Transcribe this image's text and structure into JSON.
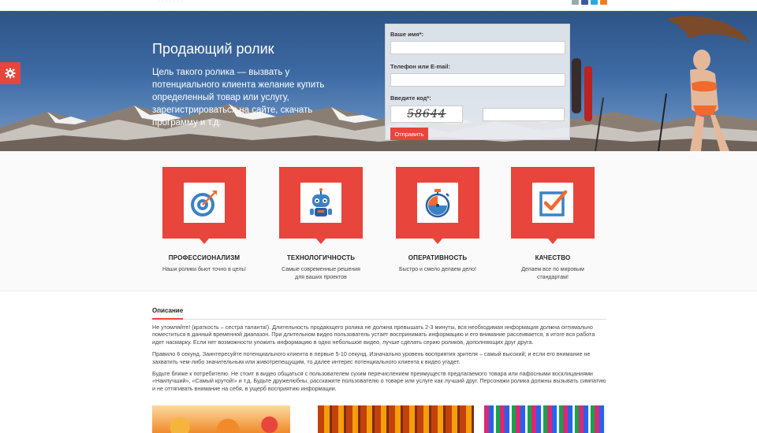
{
  "hero": {
    "title": "Продающий ролик",
    "text": "Цель такого ролика — вызвать у потенциального клиента желание купить определенный товар или услугу, зарегистрироваться на сайте, скачать программу и т.д."
  },
  "form": {
    "name_label": "Ваше имя*:",
    "name_value": "",
    "phone_label": "Телефон или E-mail:",
    "phone_value": "",
    "code_label": "Введите код*:",
    "code_value": "",
    "captcha_text": "58644",
    "submit_label": "Отправить"
  },
  "features": [
    {
      "title": "ПРОФЕССИОНАЛИЗМ",
      "desc": "Наши ролики бьют точно в цель!",
      "icon": "target-icon"
    },
    {
      "title": "ТЕХНОЛОГИЧНОСТЬ",
      "desc": "Самые современные решения для ваших проектов",
      "icon": "robot-icon"
    },
    {
      "title": "ОПЕРАТИВНОСТЬ",
      "desc": "Быстро и смело делаем дело!",
      "icon": "stopwatch-icon"
    },
    {
      "title": "КАЧЕСТВО",
      "desc": "Делаем все по мировым стандартам!",
      "icon": "checkbox-icon"
    }
  ],
  "description": {
    "tab": "Описание",
    "p1": "Не утомляйте! (краткость – сестра таланта!). Длительность продающего ролика не должна превышать 2-3 минуты, вся необходимая информация должна оптимально поместиться в данный временной диапазон. При длительном видео пользователь устает воспринимать информацию и его внимание рассеивается, в итоге вся работа идет насмарку.  Если нет возможности уложить информацию в одно небольшое видео, лучше сделать серию роликов, дополняющих друг друга.",
    "p2": "Правило 6 секунд. Заинтересуйте потенциального клиента в первые 5-10 секунд. Изначально уровень восприятия зрителя – самый высокий; и если его внимание не захватить чем-либо значительным или животрепещущим, то далее интерес потенциального клиента к видео угадет.",
    "p3": "Будьте ближе к потребителю. Не стоит в видео общаться с пользователем сухим перечислением преимуществ предлагаемого товара или пафосными восклицаниями «Наилучший», «Самый крутой!» и т.д. Будьте дружелюбны, расскажите пользователю о товаре или услуге как лучший друг. Персонажи ролика должны вызывать симпатию и не оттягивать внимание на себя, в ущерб восприятию информации."
  },
  "colors": {
    "accent": "#e8453c"
  }
}
